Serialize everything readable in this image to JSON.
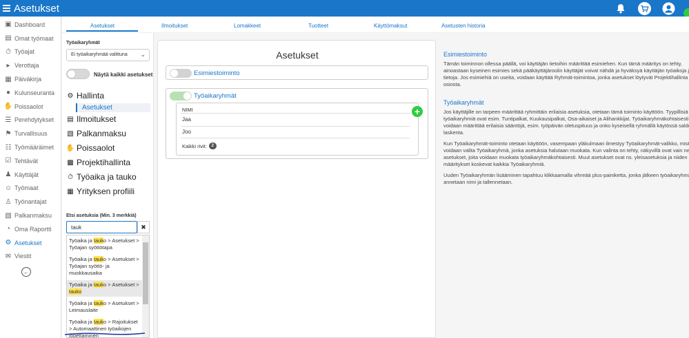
{
  "topbar": {
    "title": "Asetukset",
    "icons": [
      "menu-icon",
      "bell-icon",
      "cart-icon",
      "account-icon"
    ]
  },
  "sidebar": {
    "items": [
      {
        "label": "Dashboard",
        "icon": "dashboard-icon"
      },
      {
        "label": "Omat työmaat",
        "icon": "worksites-icon"
      },
      {
        "label": "Työajat",
        "icon": "stopwatch-icon"
      },
      {
        "label": "Verottaja",
        "icon": "megaphone-icon"
      },
      {
        "label": "Päiväkirja",
        "icon": "book-icon"
      },
      {
        "label": "Kulunseuranta",
        "icon": "location-icon"
      },
      {
        "label": "Poissaolot",
        "icon": "hand-icon"
      },
      {
        "label": "Perehdytykset",
        "icon": "list-icon"
      },
      {
        "label": "Turvallisuus",
        "icon": "flag-icon"
      },
      {
        "label": "Työmääräimet",
        "icon": "tasks-icon"
      },
      {
        "label": "Tehtävät",
        "icon": "checklist-icon"
      },
      {
        "label": "Käyttäjät",
        "icon": "users-icon"
      },
      {
        "label": "Työmaat",
        "icon": "user-icon"
      },
      {
        "label": "Työnantajat",
        "icon": "employer-icon"
      },
      {
        "label": "Palkanmaksu",
        "icon": "money-icon"
      },
      {
        "label": "Oma Raportti",
        "icon": "pie-chart-icon"
      },
      {
        "label": "Asetukset",
        "icon": "gear-icon",
        "active": true
      },
      {
        "label": "Viestit",
        "icon": "mail-icon"
      }
    ]
  },
  "tabs": [
    "Asetukset",
    "Ilmoitukset",
    "Lomakkeet",
    "Tuotteet",
    "Käyttömaksut",
    "Asetusten historia"
  ],
  "settings_nav": {
    "group_label": "Työaikaryhmät",
    "group_select_value": "Ei työaikaryhmää valittuna",
    "show_all_label": "Näytä kaikki asetukset",
    "sections": [
      "Hallinta",
      "Ilmoitukset",
      "Palkanmaksu",
      "Poissaolot",
      "Projektihallinta",
      "Työaika ja tauko",
      "Yrityksen profiili"
    ],
    "sub_item": "Asetukset",
    "search_label": "Etsi asetuksia (Min. 3 merkkiä)",
    "search_value": "tauk",
    "results": [
      {
        "pre": "Työaika ja ",
        "hl": "tauk",
        "post": "o > Asetukset >",
        "line2": "Työajan syöttötapa",
        "line3": ""
      },
      {
        "pre": "Työaika ja ",
        "hl": "tauk",
        "post": "o > Asetukset >",
        "line2": "Työajan syöttö- ja",
        "line3": "muokkausaika"
      },
      {
        "pre": "Työaika ja ",
        "hl": "tauk",
        "post": "o > Asetukset >",
        "line2": "tauko",
        "line3": ""
      },
      {
        "pre": "Työaika ja ",
        "hl": "tauk",
        "post": "o > Asetukset >",
        "line2": "Leimauslaite",
        "line3": ""
      },
      {
        "pre": "Työaika ja ",
        "hl": "tauk",
        "post": "o > Rajoitukset",
        "line2": "> Automaattinen työaikojen",
        "line3": "lopettaminen"
      }
    ]
  },
  "main": {
    "title": "Asetukset",
    "manager_section": "Esimiestoiminto",
    "groups_section": "Työaikaryhmät",
    "table_header": "NIMI",
    "rows": [
      "Jaa",
      "Joo"
    ],
    "total_label": "Kaikki rivit:",
    "total_count": "2"
  },
  "help": {
    "title1": "Esimiestoiminto",
    "p1": [
      "Tämän toiminnon ollessa päällä, voi käyttäjän tietoihin määrittää esimiehen. Kun tämä määritys on tehty,",
      "ainoastaan kyseinen esimies sekä pääkäyttäjäroolin käyttäjät voivat nähdä ja hyväksyä käyttäjän työaikoja ja",
      "tietoja. Jos esimiehiä on useita, voidaan käyttää Ryhmät-toimintoa, jonka asetukset löytyvät Projektihallinta",
      "osiosta."
    ],
    "title2": "Työaikaryhmät",
    "p2": [
      "Jos käyttäjille on tarpeen määrittää ryhmittäin erilaisia asetuksia, otetaan tämä toiminto käyttöön. Tyypillisiä",
      "työaikaryhmiä ovat esim. Tuntipalkat, Kuukausipalkat, Osa-aikaiset ja Alihankkijat. Työaikaryhmäkohtaisesti",
      "voidaan määrittää erilaisia sääntöjä, esim. työpäivän oletuspituus ja onko kyseisellä ryhmällä käytössä saldot",
      "laskenta."
    ],
    "p3": [
      "Kun Työaikaryhmät-toiminto otetaan käyttöön, vasempaan yläkulmaan ilmestyy Työaikaryhmät-valikko, mistä",
      "voidaan valita Työaikaryhmä, jonka asetuksia halutaan muokata. Kun valinta on tehty, näkyvillä ovat vain ne",
      "asetukset, joita voidaan muokata työaikaryhmäkohtaisesti. Muut asetukset ovat ns. yleisasetuksia ja niiden",
      "määritykset koskevat kaikkia Työaikaryhmiä."
    ],
    "p4": [
      "Uuden Työaikaryhmän lisääminen tapahtuu klikkaamalla vihreää plus-painiketta, jonka jälkeen työaikaryhmälle",
      "annetaan nimi ja tallennetaan."
    ]
  },
  "colors": {
    "brand": "#1976c9",
    "add": "#2ecc40",
    "highlight": "#ffe14d"
  }
}
